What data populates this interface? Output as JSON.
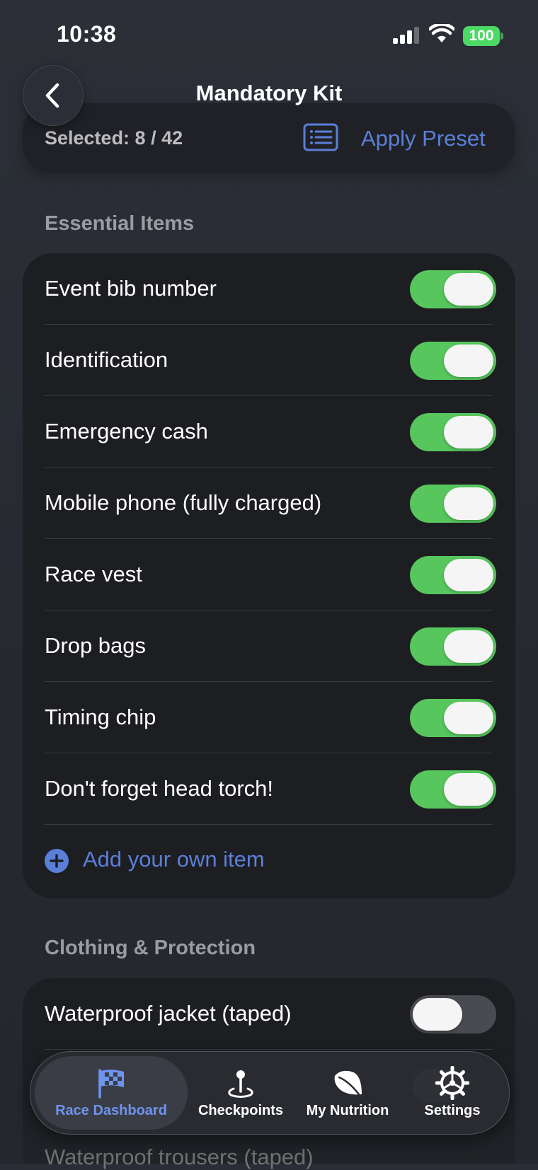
{
  "status_bar": {
    "time": "10:38",
    "battery": "100"
  },
  "header": {
    "title": "Mandatory Kit"
  },
  "summary": {
    "selected_label": "Selected: 8 / 42",
    "apply_preset": "Apply Preset"
  },
  "sections": {
    "essential": {
      "title": "Essential Items",
      "items": [
        {
          "label": "Event bib number",
          "on": true
        },
        {
          "label": "Identification",
          "on": true
        },
        {
          "label": "Emergency cash",
          "on": true
        },
        {
          "label": "Mobile phone (fully charged)",
          "on": true
        },
        {
          "label": "Race vest",
          "on": true
        },
        {
          "label": "Drop bags",
          "on": true
        },
        {
          "label": "Timing chip",
          "on": true
        },
        {
          "label": "Don't forget head torch!",
          "on": true
        }
      ],
      "add_label": "Add your own item"
    },
    "clothing": {
      "title": "Clothing & Protection",
      "items": [
        {
          "label": "Waterproof jacket (taped)",
          "on": false
        },
        {
          "label": "Waterproof trousers (taped)",
          "on": false
        }
      ]
    }
  },
  "tabs": [
    {
      "label": "Race Dashboard",
      "icon": "checkered-flag-icon",
      "active": true
    },
    {
      "label": "Checkpoints",
      "icon": "map-pin-icon",
      "active": false
    },
    {
      "label": "My Nutrition",
      "icon": "leaf-icon",
      "active": false
    },
    {
      "label": "Settings",
      "icon": "gear-icon",
      "active": false
    }
  ],
  "colors": {
    "accent": "#5b7fd8",
    "toggle_on": "#57c75d",
    "card": "#1d1e22"
  }
}
